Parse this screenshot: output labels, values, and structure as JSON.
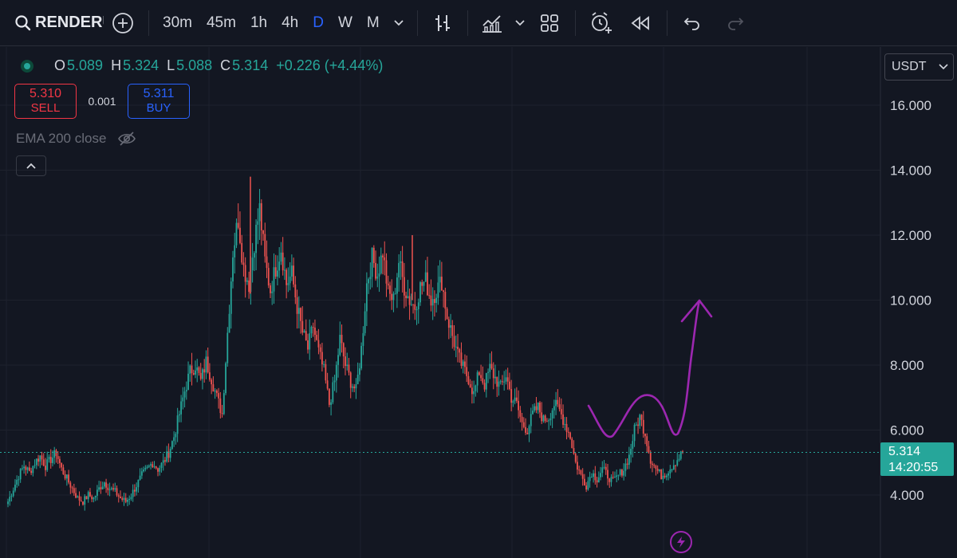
{
  "toolbar": {
    "symbol": "RENDERU",
    "symbol_icon": "search-icon",
    "add_icon": "plus-circle-icon",
    "timeframes": [
      "30m",
      "45m",
      "1h",
      "4h",
      "D",
      "W",
      "M"
    ],
    "active_timeframe": "D",
    "icons": [
      "chevron-down-icon",
      "bar-style-icon",
      "indicators-icon",
      "chevron-down-icon",
      "layout-grid-icon",
      "alert-icon",
      "replay-icon",
      "undo-icon",
      "redo-icon"
    ]
  },
  "legend": {
    "open_label": "O",
    "open": "5.089",
    "high_label": "H",
    "high": "5.324",
    "low_label": "L",
    "low": "5.088",
    "close_label": "C",
    "close": "5.314",
    "change": "+0.226 (+4.44%)"
  },
  "trade": {
    "sell_price": "5.310",
    "sell_label": "SELL",
    "spread": "0.001",
    "buy_price": "5.311",
    "buy_label": "BUY"
  },
  "indicator": {
    "label": "EMA 200 close",
    "visibility_icon": "eye-off-icon"
  },
  "currency": {
    "label": "USDT"
  },
  "price_axis": {
    "labels": [
      "16.000",
      "14.000",
      "12.000",
      "10.000",
      "8.000",
      "6.000",
      "4.000"
    ],
    "current_price": "5.314",
    "countdown": "14:20:55"
  },
  "colors": {
    "up": "#26a69a",
    "down": "#ef5350",
    "drawing": "#9c27b0",
    "accent": "#2962ff",
    "background": "#131722"
  },
  "chart_data": {
    "type": "line",
    "description_series": "daily close prices (approximate)",
    "y_axis": {
      "min": 3.0,
      "max": 16.5,
      "ticks": [
        4,
        6,
        8,
        10,
        12,
        14,
        16
      ]
    },
    "current_price": 5.314,
    "series": [
      {
        "values": [
          3.8,
          4.2,
          4.6,
          4.9,
          4.7,
          5.0,
          5.2,
          4.9,
          5.1,
          5.3,
          4.8,
          4.5,
          4.2,
          3.9,
          3.8,
          4.0,
          3.9,
          4.2,
          4.4,
          4.2,
          4.1,
          3.9,
          3.8,
          4.0,
          4.3,
          4.6,
          4.8,
          5.0,
          4.8,
          5.0,
          5.3,
          5.8,
          6.5,
          7.2,
          7.8,
          8.0,
          7.5,
          8.1,
          7.6,
          7.0,
          6.5,
          9.0,
          11.5,
          12.5,
          11.0,
          10.5,
          11.8,
          12.8,
          11.2,
          10.3,
          11.0,
          11.6,
          10.5,
          10.8,
          9.8,
          9.0,
          8.5,
          9.2,
          8.4,
          7.8,
          6.8,
          7.5,
          8.8,
          8.0,
          7.5,
          7.2,
          8.5,
          10.5,
          11.3,
          10.8,
          11.5,
          10.2,
          10.0,
          11.2,
          10.4,
          10.0,
          9.8,
          10.4,
          10.6,
          10.0,
          10.3,
          10.6,
          9.5,
          8.9,
          8.3,
          7.9,
          7.6,
          7.1,
          7.8,
          7.4,
          7.9,
          7.6,
          7.3,
          7.7,
          7.0,
          6.8,
          6.2,
          6.0,
          6.5,
          6.7,
          6.3,
          6.4,
          6.8,
          6.6,
          6.2,
          5.8,
          5.0,
          4.6,
          4.3,
          4.7,
          4.5,
          4.8,
          4.6,
          4.4,
          4.6,
          4.8,
          5.2,
          6.0,
          6.4,
          5.9,
          5.1,
          4.8,
          4.6,
          4.7,
          4.9,
          5.1,
          5.314
        ],
        "highs": [
          13.8,
          12.0
        ]
      }
    ]
  },
  "drawing": {
    "type": "hand-drawn projection arrow",
    "target_price": 10.0
  },
  "footer_icon": "flash-icon"
}
